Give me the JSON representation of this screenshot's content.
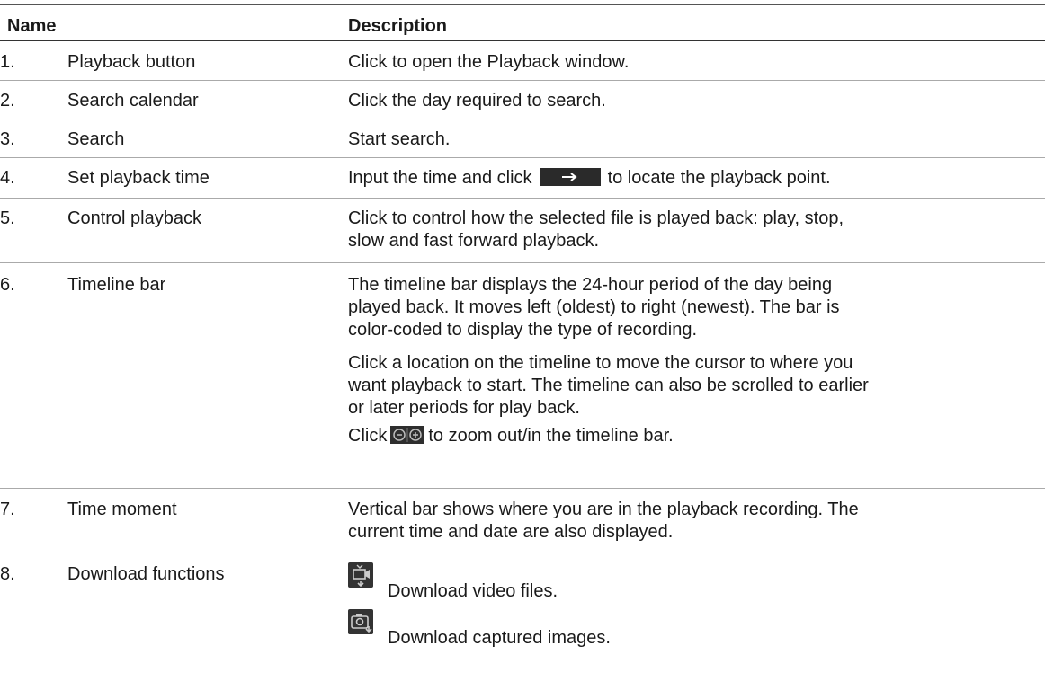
{
  "header": {
    "name": "Name",
    "description": "Description"
  },
  "rows": [
    {
      "num": "1.",
      "name": "Playback button",
      "desc": "Click to open the Playback window."
    },
    {
      "num": "2.",
      "name": "Search calendar",
      "desc": "Click the day required to search."
    },
    {
      "num": "3.",
      "name": "Search",
      "desc": "Start search."
    },
    {
      "num": "4.",
      "name": "Set playback time",
      "desc_a": "Input the time and click",
      "desc_b": "to locate the playback point."
    },
    {
      "num": "5.",
      "name": "Control playback",
      "desc_l1": "Click to control how the selected file is played back:  play, stop,",
      "desc_l2": "slow and fast forward playback."
    },
    {
      "num": "6.",
      "name": "Timeline bar",
      "p1_l1": "The timeline bar displays the 24-hour period of the day being",
      "p1_l2": "played back. It moves left (oldest) to right (newest). The bar is",
      "p1_l3": "color-coded to display the type of recording.",
      "p2_l1": "Click a location on the timeline to move the cursor to where you",
      "p2_l2": "want playback to start. The timeline can also be scrolled to earlier",
      "p2_l3": "or later periods for play back.",
      "p3_a": "Click",
      "p3_b": "to zoom out/in the timeline bar."
    },
    {
      "num": "7.",
      "name": "Time moment",
      "desc_l1": "Vertical bar shows where you are in the playback recording. The",
      "desc_l2": "current time and date are also displayed."
    },
    {
      "num": "8.",
      "name": "Download functions",
      "d1": "Download video files.",
      "d2": "Download captured images."
    }
  ],
  "icons": [
    "arrow-right-icon",
    "zoom-out-in-icon",
    "download-video-icon",
    "download-image-icon"
  ]
}
